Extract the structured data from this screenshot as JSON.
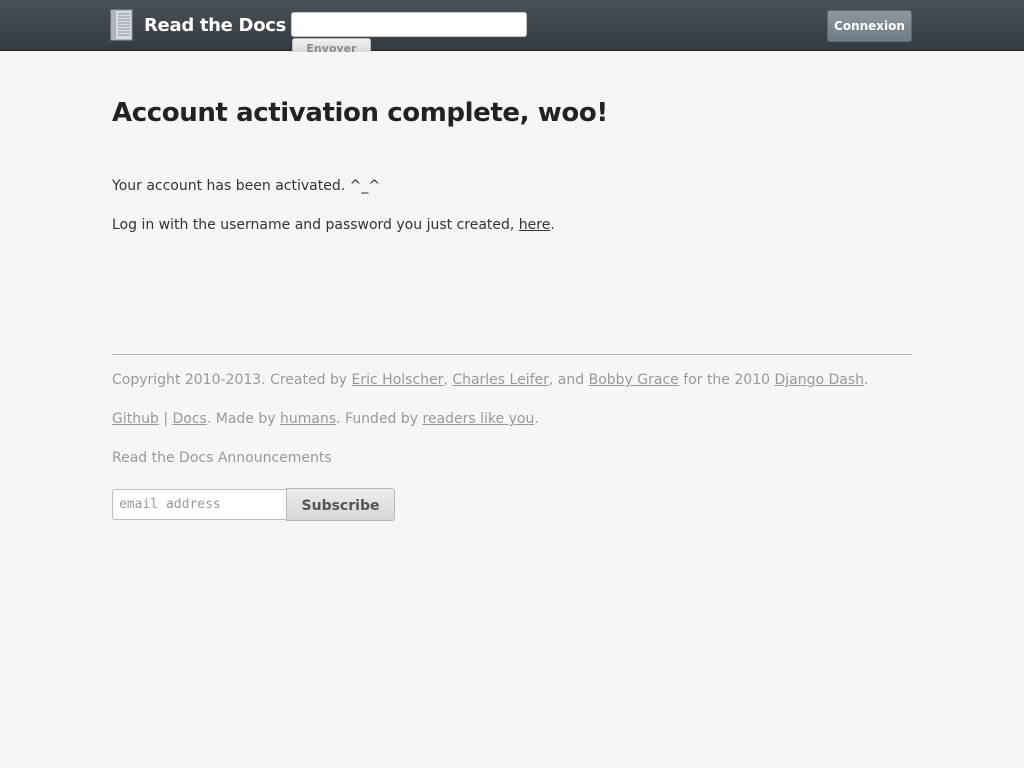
{
  "header": {
    "logo_text": "Read the Docs",
    "logo_icon": "book-stack-icon",
    "search": {
      "placeholder": "",
      "value": "",
      "submit_label": "Envoyer"
    },
    "login_label": "Connexion"
  },
  "main": {
    "title": "Account activation complete, woo!",
    "activated_text": "Your account has been activated. ^_^",
    "login_text_before": "Log in with the username and password you just created, ",
    "login_link": "here",
    "login_text_after": "."
  },
  "footer": {
    "copyright_prefix": "Copyright 2010-2013. Created by ",
    "author1": "Eric Holscher",
    "sep1": ", ",
    "author2": "Charles Leifer",
    "sep2": ", and ",
    "author3": "Bobby Grace",
    "for_text": " for the 2010 ",
    "django_dash": "Django Dash",
    "end_period": ".",
    "github": "Github",
    "pipe": " | ",
    "docs": "Docs",
    "made_by": ". Made by ",
    "humans": "humans",
    "funded_by": ". Funded by ",
    "readers": "readers like you",
    "end_period2": ".",
    "announcements": "Read the Docs Announcements",
    "email_placeholder": "email address",
    "subscribe_label": "Subscribe"
  },
  "colors": {
    "header_bg": "#3f464c",
    "page_bg": "#f6f6f4",
    "button_primary": "#7f8c95"
  }
}
